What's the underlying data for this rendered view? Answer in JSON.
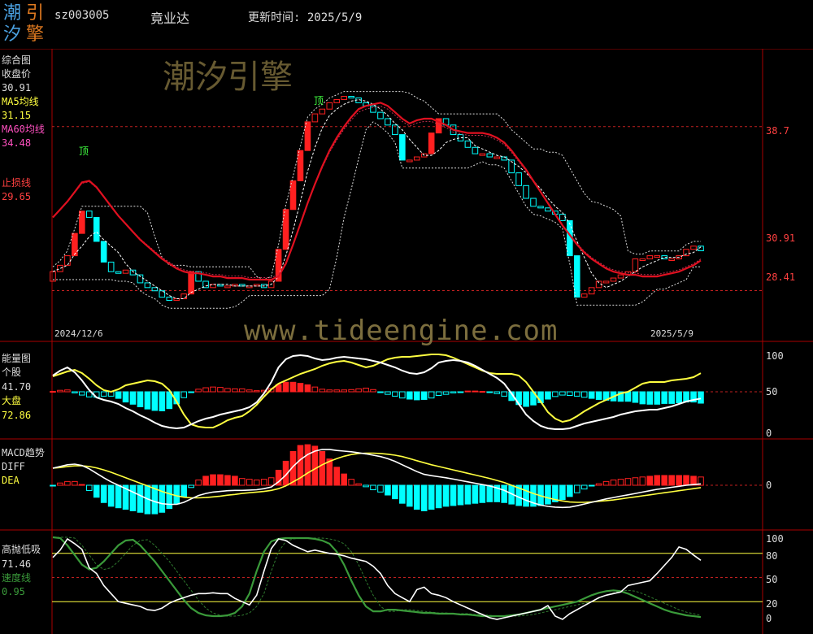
{
  "header": {
    "logo_text": [
      "潮",
      "汐",
      "引",
      "擎"
    ],
    "stock_code": "sz003005",
    "stock_name": "竟业达",
    "update_label": "更新时间: 2025/5/9"
  },
  "watermark": {
    "cn": "潮汐引擎",
    "url": "www.tideengine.com"
  },
  "panel_main": {
    "title": "综合图",
    "close_label": "收盘价",
    "close_value": "30.91",
    "ma5_label": "MA5均线",
    "ma5_value": "31.15",
    "ma60_label": "MA60均线",
    "ma60_value": "34.48",
    "stop_label": "止损线",
    "stop_value": "29.65",
    "axis": [
      "38.7",
      "30.91",
      "28.41"
    ],
    "date_start": "2024/12/6",
    "date_end": "2025/5/9",
    "top_marks": [
      "顶",
      "顶"
    ]
  },
  "panel_energy": {
    "title": "能量图",
    "stock_label": "个股",
    "stock_value": "41.70",
    "market_label": "大盘",
    "market_value": "72.86",
    "axis": [
      "100",
      "50",
      "0"
    ]
  },
  "panel_macd": {
    "title": "MACD趋势",
    "diff_label": "DIFF",
    "dea_label": "DEA",
    "axis": [
      "0"
    ]
  },
  "panel_kdj": {
    "title": "高抛低吸",
    "value1": "71.46",
    "speed_label": "速度线",
    "speed_value": "0.95",
    "axis": [
      "100",
      "80",
      "50",
      "20",
      "0"
    ]
  },
  "colors": {
    "up": "#ff2020",
    "down": "#00ffff",
    "ma60": "#e01020",
    "label_red": "#ff4040",
    "label_yellow": "#ffff40",
    "label_pink": "#ff50c0",
    "label_green": "#3a9a3a",
    "grid": "#aa0000"
  },
  "chart_data": [
    {
      "type": "line",
      "title": "综合图",
      "series": [
        {
          "name": "收盘价",
          "values": [
            29.6,
            30.0,
            30.6,
            32.0,
            33.4,
            33.0,
            31.5,
            30.2,
            29.6,
            29.5,
            29.7,
            29.4,
            28.9,
            28.6,
            28.4,
            28.0,
            27.8,
            27.9,
            28.2,
            29.6,
            29.0,
            28.6,
            28.8,
            28.7,
            28.7,
            28.8,
            28.7,
            28.7,
            28.8,
            28.6,
            29.0,
            31.0,
            33.5,
            35.3,
            37.2,
            39.0,
            39.5,
            39.8,
            40.2,
            40.4,
            40.6,
            40.5,
            40.2,
            40.0,
            39.6,
            39.2,
            38.8,
            38.2,
            36.6,
            36.6,
            36.8,
            37.0,
            38.3,
            39.2,
            38.8,
            38.2,
            37.8,
            37.4,
            37.0,
            37.0,
            36.8,
            36.8,
            36.6,
            35.8,
            35.0,
            34.2,
            33.7,
            33.6,
            33.4,
            33.2,
            32.8,
            30.6,
            28.0,
            28.2,
            28.6,
            29.0,
            29.0,
            29.2,
            29.4,
            29.6,
            30.4,
            30.4,
            30.6,
            30.6,
            30.4,
            30.4,
            30.6,
            31.0,
            31.2,
            30.91
          ]
        },
        {
          "name": "MA5均线",
          "values": [
            29.6,
            29.8,
            30.0,
            30.7,
            31.2,
            31.8,
            32.1,
            31.6,
            31.2,
            30.8,
            30.1,
            29.6,
            29.3,
            29.0,
            28.7,
            28.4,
            28.1,
            27.9,
            27.9,
            28.3,
            28.5,
            28.7,
            28.8,
            28.8,
            28.8,
            28.7,
            28.7,
            28.7,
            28.7,
            28.7,
            28.8,
            29.3,
            30.6,
            32.2,
            34.0,
            35.9,
            37.4,
            38.6,
            39.4,
            39.8,
            40.1,
            40.3,
            40.4,
            40.3,
            40.1,
            39.8,
            39.4,
            38.9,
            38.5,
            37.9,
            37.4,
            36.9,
            36.9,
            37.2,
            37.7,
            37.9,
            38.0,
            38.0,
            37.5,
            37.3,
            37.1,
            36.9,
            36.8,
            36.5,
            36.2,
            35.8,
            35.3,
            34.8,
            34.2,
            33.7,
            33.3,
            32.6,
            31.5,
            30.5,
            29.5,
            28.9,
            28.6,
            28.8,
            29.0,
            29.3,
            29.6,
            29.9,
            30.1,
            30.3,
            30.5,
            30.5,
            30.5,
            30.7,
            30.8,
            31.15
          ]
        },
        {
          "name": "MA60均线",
          "values": [
            33.0,
            33.5,
            34.0,
            34.6,
            35.2,
            35.3,
            34.9,
            34.3,
            33.7,
            33.1,
            32.6,
            32.1,
            31.6,
            31.2,
            30.8,
            30.4,
            30.1,
            29.8,
            29.6,
            29.5,
            29.5,
            29.4,
            29.3,
            29.3,
            29.2,
            29.2,
            29.2,
            29.1,
            29.1,
            29.1,
            29.1,
            29.3,
            30.1,
            31.3,
            32.6,
            33.9,
            35.1,
            36.2,
            37.2,
            38.0,
            38.7,
            39.3,
            39.8,
            40.0,
            40.1,
            40.2,
            40.0,
            39.6,
            39.2,
            38.9,
            39.1,
            39.2,
            39.2,
            39.0,
            38.8,
            38.5,
            38.4,
            38.3,
            38.3,
            38.3,
            38.2,
            38.0,
            37.7,
            37.2,
            36.6,
            36.0,
            35.3,
            34.6,
            33.9,
            33.2,
            32.5,
            31.9,
            31.3,
            30.8,
            30.4,
            30.1,
            29.8,
            29.6,
            29.5,
            29.4,
            29.4,
            29.3,
            29.3,
            29.3,
            29.4,
            29.5,
            29.6,
            29.8,
            30.0,
            30.3
          ]
        }
      ],
      "axis_labels": [
        "38.7",
        "30.91",
        "28.41"
      ],
      "x_labels": [
        "2024/12/6",
        "2025/5/9"
      ]
    },
    {
      "type": "line",
      "title": "能量图",
      "ylim": [
        0,
        100
      ],
      "series": [
        {
          "name": "个股",
          "values": [
            70,
            76,
            80,
            74,
            64,
            52,
            43,
            40,
            38,
            35,
            30,
            26,
            21,
            17,
            12,
            8,
            6,
            5,
            6,
            10,
            14,
            17,
            19,
            22,
            24,
            26,
            28,
            31,
            37,
            48,
            62,
            80,
            90,
            94,
            95,
            94,
            91,
            89,
            90,
            92,
            93,
            92,
            91,
            90,
            88,
            86,
            83,
            80,
            76,
            73,
            72,
            74,
            79,
            86,
            88,
            89,
            88,
            86,
            82,
            77,
            72,
            67,
            60,
            48,
            35,
            22,
            14,
            8,
            5,
            4,
            4,
            5,
            8,
            11,
            13,
            15,
            17,
            19,
            22,
            24,
            26,
            27,
            28,
            28,
            30,
            32,
            35,
            38,
            40,
            41.7
          ]
        },
        {
          "name": "大盘",
          "values": [
            69,
            72,
            75,
            77,
            73,
            66,
            58,
            52,
            50,
            53,
            58,
            60,
            62,
            64,
            63,
            60,
            52,
            38,
            22,
            10,
            7,
            6,
            6,
            10,
            15,
            18,
            20,
            26,
            34,
            44,
            53,
            60,
            64,
            68,
            72,
            75,
            78,
            82,
            85,
            87,
            88,
            86,
            83,
            80,
            82,
            86,
            90,
            92,
            93,
            93,
            94,
            95,
            96,
            96,
            95,
            92,
            88,
            84,
            80,
            76,
            73,
            72,
            72,
            72,
            70,
            62,
            50,
            38,
            25,
            17,
            13,
            15,
            20,
            26,
            31,
            36,
            40,
            44,
            48,
            50,
            55,
            60,
            62,
            62,
            62,
            64,
            65,
            66,
            68,
            72.86
          ]
        }
      ],
      "axis_labels": [
        "100",
        "50",
        "0"
      ]
    },
    {
      "type": "bar",
      "title": "MACD趋势",
      "series": [
        {
          "name": "DIFF",
          "values": [
            0.5,
            0.55,
            0.6,
            0.62,
            0.58,
            0.48,
            0.35,
            0.22,
            0.1,
            0.0,
            -0.1,
            -0.2,
            -0.3,
            -0.4,
            -0.48,
            -0.54,
            -0.56,
            -0.56,
            -0.5,
            -0.4,
            -0.3,
            -0.24,
            -0.2,
            -0.18,
            -0.16,
            -0.15,
            -0.15,
            -0.14,
            -0.13,
            -0.1,
            -0.05,
            0.1,
            0.3,
            0.55,
            0.75,
            0.9,
            1.0,
            1.05,
            1.05,
            1.02,
            1.0,
            0.98,
            0.95,
            0.92,
            0.88,
            0.84,
            0.78,
            0.7,
            0.6,
            0.5,
            0.4,
            0.32,
            0.28,
            0.25,
            0.22,
            0.18,
            0.14,
            0.1,
            0.06,
            0.02,
            -0.02,
            -0.08,
            -0.15,
            -0.25,
            -0.35,
            -0.44,
            -0.52,
            -0.58,
            -0.62,
            -0.64,
            -0.65,
            -0.64,
            -0.6,
            -0.55,
            -0.5,
            -0.45,
            -0.4,
            -0.36,
            -0.32,
            -0.28,
            -0.24,
            -0.2,
            -0.16,
            -0.12,
            -0.09,
            -0.06,
            -0.03,
            0.0,
            0.02,
            0.04
          ]
        },
        {
          "name": "DEA",
          "values": [
            0.5,
            0.52,
            0.55,
            0.57,
            0.57,
            0.55,
            0.51,
            0.45,
            0.38,
            0.3,
            0.22,
            0.14,
            0.06,
            -0.02,
            -0.1,
            -0.18,
            -0.25,
            -0.31,
            -0.35,
            -0.37,
            -0.37,
            -0.36,
            -0.34,
            -0.32,
            -0.29,
            -0.27,
            -0.24,
            -0.22,
            -0.2,
            -0.18,
            -0.15,
            -0.1,
            -0.02,
            0.1,
            0.22,
            0.36,
            0.48,
            0.6,
            0.7,
            0.78,
            0.85,
            0.9,
            0.93,
            0.94,
            0.94,
            0.93,
            0.91,
            0.88,
            0.84,
            0.78,
            0.72,
            0.66,
            0.6,
            0.55,
            0.5,
            0.45,
            0.4,
            0.35,
            0.3,
            0.25,
            0.2,
            0.14,
            0.08,
            0.0,
            -0.08,
            -0.16,
            -0.24,
            -0.31,
            -0.37,
            -0.42,
            -0.46,
            -0.49,
            -0.5,
            -0.5,
            -0.49,
            -0.47,
            -0.45,
            -0.43,
            -0.4,
            -0.37,
            -0.34,
            -0.31,
            -0.28,
            -0.25,
            -0.22,
            -0.19,
            -0.16,
            -0.13,
            -0.1,
            -0.07
          ]
        }
      ],
      "axis_labels": [
        "0"
      ]
    },
    {
      "type": "line",
      "title": "高抛低吸",
      "ylim": [
        0,
        100
      ],
      "series": [
        {
          "name": "高抛低吸",
          "values": [
            75,
            84,
            98,
            92,
            85,
            62,
            55,
            40,
            30,
            20,
            18,
            16,
            14,
            10,
            9,
            12,
            18,
            22,
            25,
            28,
            30,
            30,
            31,
            30,
            30,
            24,
            20,
            16,
            28,
            58,
            86,
            98,
            96,
            90,
            86,
            82,
            84,
            82,
            80,
            79,
            77,
            74,
            72,
            70,
            64,
            55,
            40,
            30,
            25,
            20,
            35,
            38,
            30,
            28,
            25,
            20,
            16,
            12,
            8,
            4,
            0,
            -2,
            0,
            2,
            4,
            6,
            8,
            10,
            15,
            2,
            -2,
            5,
            10,
            15,
            20,
            25,
            28,
            30,
            32,
            40,
            42,
            44,
            46,
            55,
            65,
            75,
            88,
            85,
            78,
            71.46
          ]
        },
        {
          "name": "速度线",
          "values": [
            100,
            99,
            90,
            78,
            66,
            60,
            62,
            70,
            80,
            90,
            96,
            97,
            90,
            80,
            70,
            58,
            46,
            34,
            22,
            12,
            6,
            3,
            2,
            2,
            3,
            6,
            14,
            30,
            58,
            82,
            95,
            98,
            99,
            99,
            99,
            99,
            98,
            96,
            92,
            82,
            66,
            46,
            28,
            14,
            8,
            8,
            10,
            10,
            9,
            8,
            7,
            6,
            6,
            5,
            5,
            5,
            4,
            4,
            3,
            2,
            2,
            2,
            2,
            3,
            4,
            6,
            8,
            10,
            12,
            14,
            16,
            18,
            20,
            24,
            28,
            31,
            33,
            34,
            33,
            30,
            26,
            22,
            18,
            14,
            10,
            7,
            5,
            3,
            2,
            0.95
          ]
        }
      ],
      "axis_labels": [
        "100",
        "80",
        "50",
        "20",
        "0"
      ]
    }
  ]
}
